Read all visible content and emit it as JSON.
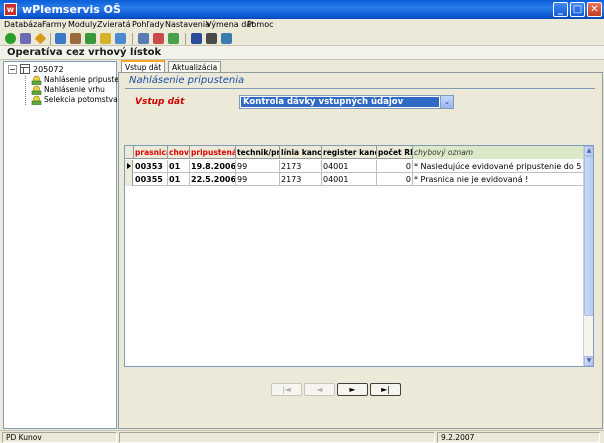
{
  "window": {
    "title": "wPlemservis OŠ",
    "controls": {
      "minimize": "_",
      "maximize": "□",
      "close": "✕"
    }
  },
  "menu": {
    "items": [
      "Databáza",
      "Farmy",
      "Moduly",
      "Zvieratá",
      "Pohľady",
      "Nastavenia",
      "Výmena dát",
      "Pomoc"
    ]
  },
  "toolbar": {
    "buttons": [
      {
        "icon": "check-icon",
        "color": "#2a9d2a"
      },
      {
        "icon": "calendar-icon",
        "color": "#6b6bb5"
      },
      {
        "icon": "diamond-icon",
        "color": "#d89a1a"
      },
      {
        "icon": "grid-icon",
        "color": "#3c78c8"
      },
      {
        "icon": "edit-icon",
        "color": "#9a6b3a"
      },
      {
        "icon": "arrow-icon",
        "color": "#3a9a3a"
      },
      {
        "icon": "folder-icon",
        "color": "#d8b22a"
      },
      {
        "icon": "report-icon",
        "color": "#4a8ad0"
      },
      {
        "icon": "config-icon",
        "color": "#5a7ab5"
      },
      {
        "icon": "chart-icon",
        "color": "#c84a4a"
      },
      {
        "icon": "graph-icon",
        "color": "#4aa04a"
      },
      {
        "icon": "save-icon",
        "color": "#2a4a9a"
      },
      {
        "icon": "print-icon",
        "color": "#4a4a4a"
      },
      {
        "icon": "monitor-icon",
        "color": "#3a7ab0"
      }
    ]
  },
  "header": {
    "title": "Operatíva cez vrhový lístok"
  },
  "tree": {
    "root": {
      "label": "205072",
      "toggle": "−"
    },
    "children": [
      {
        "label": "Nahlásenie pripustenia"
      },
      {
        "label": "Nahlásenie vrhu"
      },
      {
        "label": "Selekcia potomstva"
      }
    ]
  },
  "tabs": [
    {
      "label": "Vstup dát",
      "active": true
    },
    {
      "label": "Aktualizácia",
      "active": false
    }
  ],
  "form": {
    "section_title": "Nahlásenie pripustenia",
    "vstup_label": "Vstup dát",
    "select_value": "Kontrola dávky vstupných údajov",
    "select_arrow": "⌄"
  },
  "grid": {
    "columns": [
      {
        "label": "prasnica",
        "red": true
      },
      {
        "label": "chov",
        "red": true
      },
      {
        "label": "pripustená",
        "red": true
      },
      {
        "label": "technik/prir",
        "red": false
      },
      {
        "label": "línia kanca",
        "red": false
      },
      {
        "label": "register kanca",
        "red": false
      },
      {
        "label": "počet RE",
        "red": false
      },
      {
        "label": "chybový oznam",
        "red": false
      }
    ],
    "rows": [
      {
        "prasnica": "00353",
        "chov": "01",
        "pripustena": "19.8.2006",
        "technik": "99",
        "linia": "2173",
        "register": "04001",
        "pocet": "0",
        "oznam": "* Nasledujúce evidované pripustenie do 5 dní !",
        "selected": true
      },
      {
        "prasnica": "00355",
        "chov": "01",
        "pripustena": "22.5.2006",
        "technik": "99",
        "linia": "2173",
        "register": "04001",
        "pocet": "0",
        "oznam": "* Prasnica nie je evidovaná !",
        "selected": false
      }
    ]
  },
  "navigation": {
    "first": "|◄",
    "prev": "◄",
    "next": "►",
    "last": "►|"
  },
  "status": {
    "user": "PD Kunov",
    "middle": "",
    "date": "9.2.2007"
  }
}
